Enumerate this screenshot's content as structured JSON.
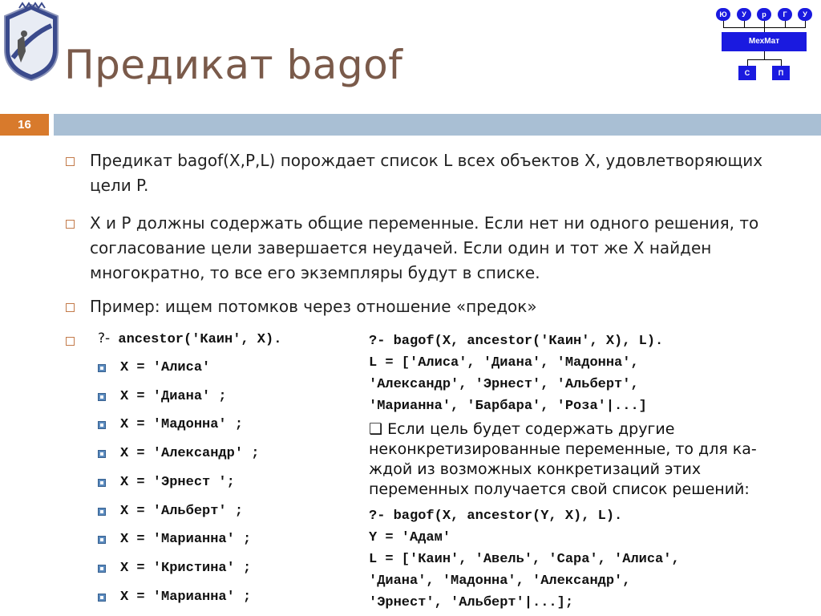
{
  "header": {
    "title": "Предикат bagof",
    "slide_number": "16"
  },
  "diagram": {
    "top_row": [
      "Ю",
      "У",
      "р",
      "Г",
      "У"
    ],
    "center": "МехМат",
    "bottom_row": [
      "С",
      "П"
    ],
    "box_color": "#1a1ae0"
  },
  "bullets": [
    "Предикат bagof(X,P,L) порождает список L всех объектов X, удовлетворяющих",
    "цели P.",
    "X и P должны содержать общие переменные. Если нет ни одного решения, то",
    "согласование цели завершается неудачей. Если один и тот же X найден",
    "многократно, то все его экземпляры будут в списке.",
    "Пример: ищем потомков через отношение «предок»"
  ],
  "query": {
    "prefix": "?-",
    "text": " ancestor('Каин', X)."
  },
  "results": [
    "X = 'Алиса'",
    "X = 'Диана' ;",
    "X = 'Мадонна' ;",
    "X = 'Александр' ;",
    "X = 'Эрнест ';",
    "X = 'Альберт' ;",
    "X = 'Марианна' ;",
    "X = 'Кристина' ;",
    "X = 'Марианна' ;"
  ],
  "right": {
    "code1": [
      "?- bagof(X, ancestor('Каин', X), L).",
      "L = ['Алиса', 'Диана', 'Мадонна',",
      "'Александр', 'Эрнест', 'Альберт',",
      "'Марианна', 'Барбара', 'Роза'|...]"
    ],
    "checkbox_glyph": "❑",
    "prose": [
      " Если цель будет содержать другие",
      "неконкретизированные переменные, то для ка-",
      "ждой из возможных конкретизаций этих",
      "переменных получается свой список решений:"
    ],
    "code2": [
      "?- bagof(X, ancestor(Y, X), L).",
      "Y = 'Адам'",
      "L = ['Каин', 'Авель', 'Сара', 'Алиса',",
      "'Диана', 'Мадонна', 'Александр',",
      "'Эрнест', 'Альберт'|...];"
    ]
  },
  "colors": {
    "title": "#7a5a4a",
    "slide_number_bg": "#d87a2c",
    "bar": "#a9bfd4",
    "sub_bullet": "#5b8bbf"
  }
}
